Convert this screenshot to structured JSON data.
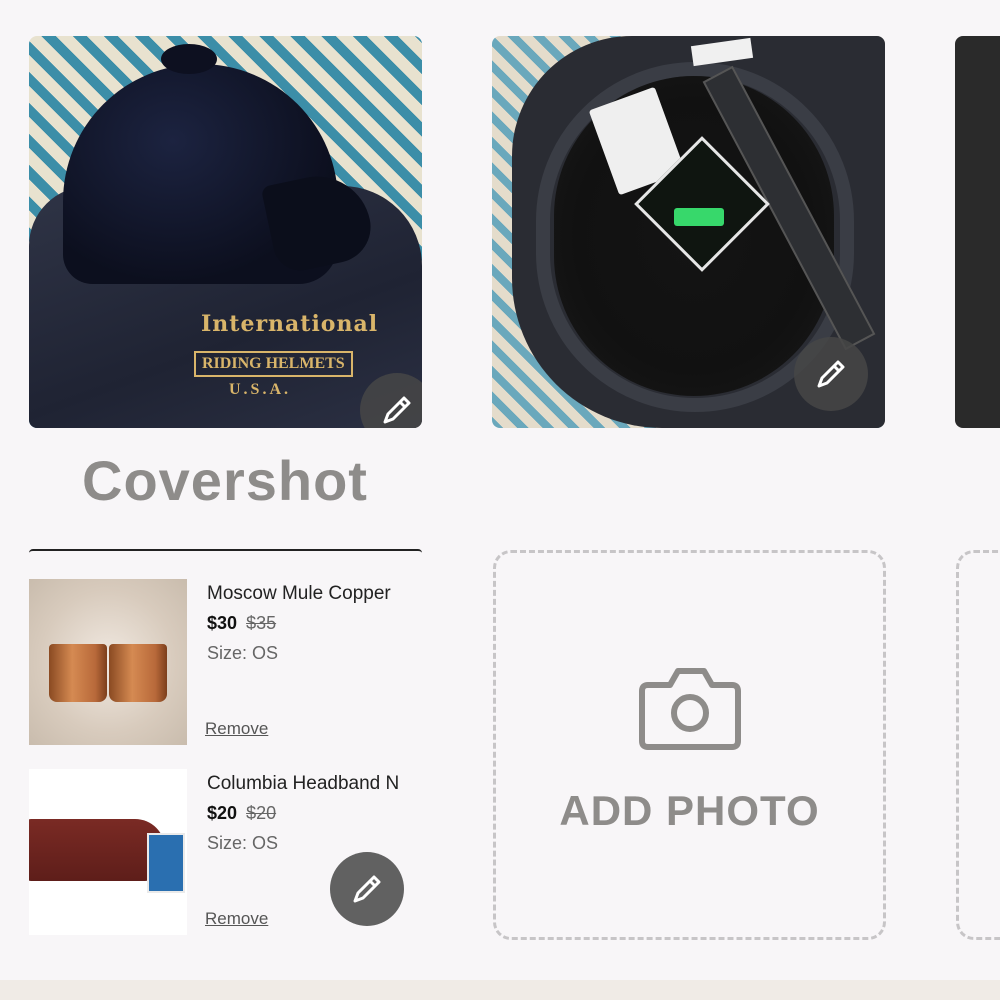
{
  "photos": [
    {
      "alt": "velvet riding helmet on bag"
    },
    {
      "alt": "inside of riding helmet"
    }
  ],
  "photo1_overlay": {
    "brand": "International",
    "line2": "RIDING HELMETS",
    "line3": "U.S.A."
  },
  "covershot_label": "Covershot",
  "bundle": {
    "items": [
      {
        "title": "Moscow Mule Copper",
        "price": "$30",
        "old_price": "$35",
        "size": "Size: OS",
        "remove": "Remove"
      },
      {
        "title": "Columbia Headband N",
        "price": "$20",
        "old_price": "$20",
        "size": "Size: OS",
        "remove": "Remove"
      }
    ]
  },
  "add_photo": {
    "label": "ADD PHOTO",
    "icon": "camera-icon"
  },
  "icons": {
    "edit": "pencil-icon"
  },
  "colors": {
    "background": "#f8f6f8",
    "muted_text": "#8e8c8a",
    "edit_button": "#464646"
  }
}
